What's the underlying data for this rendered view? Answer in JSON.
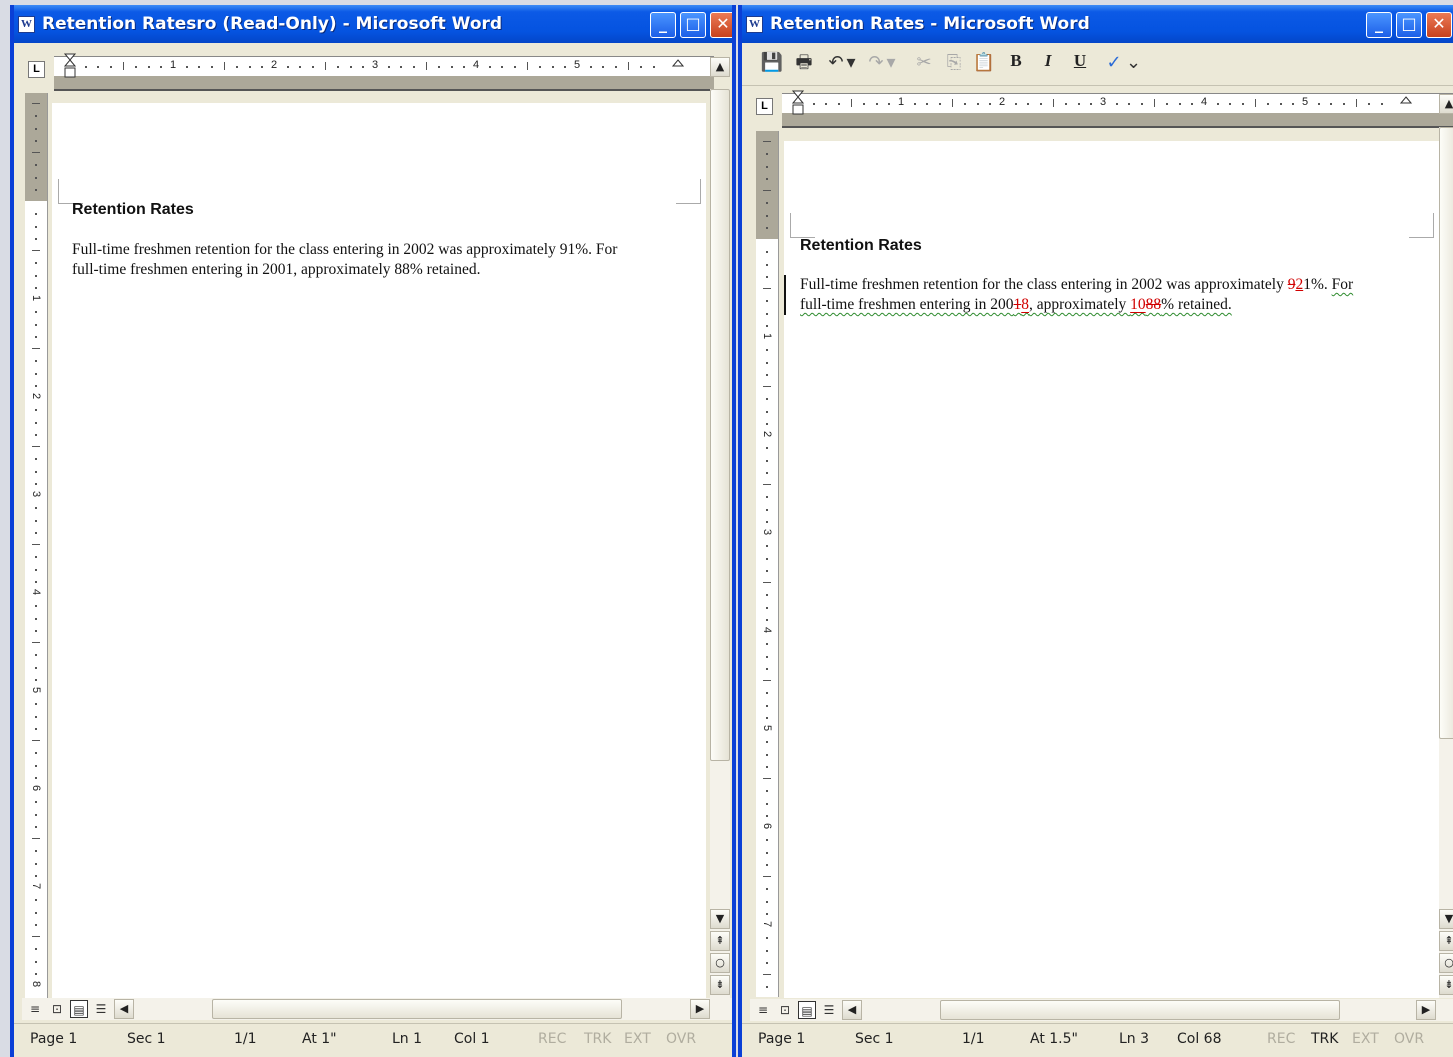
{
  "window_a": {
    "title": "Retention Ratesro (Read-Only) - Microsoft Word",
    "heading": "Retention Rates",
    "para": {
      "line1": "Full-time freshmen retention for the class entering in 2002 was approximately 91%. For",
      "line2": "full-time freshmen entering in 2001, approximately 88% retained."
    },
    "status": {
      "page": "Page 1",
      "sec": "Sec 1",
      "pages": "1/1",
      "at": "At 1\"",
      "ln": "Ln 1",
      "col": "Col 1",
      "rec": "REC",
      "trk": "TRK",
      "ext": "EXT",
      "ovr": "OVR"
    }
  },
  "window_b": {
    "title": "Retention Rates - Microsoft Word",
    "heading": "Retention Rates",
    "para": {
      "l1_text": "Full-time freshmen retention for the class entering in 2002 was approximately ",
      "l1_del": "9",
      "l1_ins": "2",
      "l1_tail": "1%. ",
      "l1_end": "For",
      "l2_a": "full-time freshmen entering in 200",
      "l2_del": "1",
      "l2_ins": "8",
      "l2_b": ", approximately ",
      "l2_ins2": "10",
      "l2_del2": "88",
      "l2_c": "% retained."
    },
    "status": {
      "page": "Page 1",
      "sec": "Sec 1",
      "pages": "1/1",
      "at": "At 1.5\"",
      "ln": "Ln 3",
      "col": "Col 68",
      "rec": "REC",
      "trk": "TRK",
      "ext": "EXT",
      "ovr": "OVR"
    }
  },
  "glyphs": {
    "word_logo": "W",
    "minimize": "_",
    "maximize": "□",
    "close": "✕",
    "tab_selector": "L",
    "save": "💾",
    "print": "🖶",
    "undo": "↶",
    "redo": "↷",
    "dropdown": "▾",
    "cut": "✂",
    "copy": "⎘",
    "paste": "📋",
    "bold": "B",
    "italic": "I",
    "underline": "U",
    "spelling": "✓",
    "more": "⌄",
    "up": "▲",
    "down": "▼",
    "left": "◀",
    "right": "▶",
    "prev_page": "⇞",
    "select_browse": "○",
    "next_page": "⇟",
    "view_normal": "≡",
    "view_web": "⊡",
    "view_print": "▤",
    "view_outline": "☰"
  },
  "ruler_numbers": [
    "1",
    "2",
    "3",
    "4",
    "5"
  ],
  "vruler_numbers": [
    "1",
    "2",
    "3",
    "4",
    "5",
    "6",
    "7",
    "8"
  ]
}
